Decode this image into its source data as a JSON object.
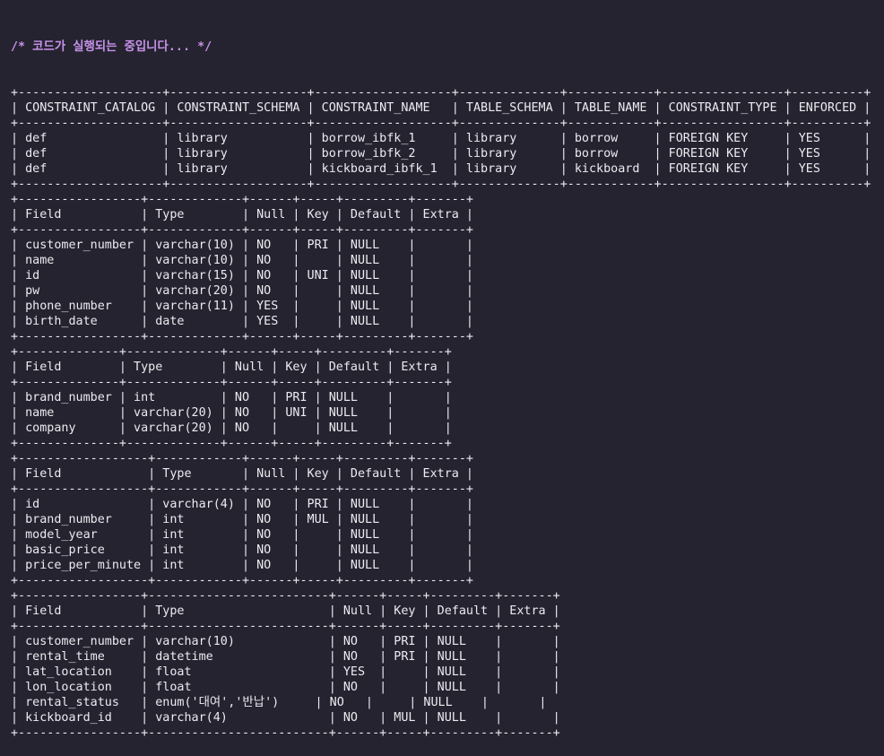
{
  "header": {
    "comment": "/* 코드가 실행되는 중입니다... */"
  },
  "results": [
    {
      "lines": [
        "+--------------------+-------------------+-------------------+--------------+------------+-----------------+----------+",
        "| CONSTRAINT_CATALOG | CONSTRAINT_SCHEMA | CONSTRAINT_NAME   | TABLE_SCHEMA | TABLE_NAME | CONSTRAINT_TYPE | ENFORCED |",
        "+--------------------+-------------------+-------------------+--------------+------------+-----------------+----------+",
        "| def                | library           | borrow_ibfk_1     | library      | borrow     | FOREIGN KEY     | YES      |",
        "| def                | library           | borrow_ibfk_2     | library      | borrow     | FOREIGN KEY     | YES      |",
        "| def                | library           | kickboard_ibfk_1  | library      | kickboard  | FOREIGN KEY     | YES      |",
        "+--------------------+-------------------+-------------------+--------------+------------+-----------------+----------+"
      ]
    },
    {
      "lines": [
        "+-----------------+-------------+------+-----+---------+-------+",
        "| Field           | Type        | Null | Key | Default | Extra |",
        "+-----------------+-------------+------+-----+---------+-------+",
        "| customer_number | varchar(10) | NO   | PRI | NULL    |       |",
        "| name            | varchar(10) | NO   |     | NULL    |       |",
        "| id              | varchar(15) | NO   | UNI | NULL    |       |",
        "| pw              | varchar(20) | NO   |     | NULL    |       |",
        "| phone_number    | varchar(11) | YES  |     | NULL    |       |",
        "| birth_date      | date        | YES  |     | NULL    |       |",
        "+-----------------+-------------+------+-----+---------+-------+"
      ]
    },
    {
      "lines": [
        "+--------------+-------------+------+-----+---------+-------+",
        "| Field        | Type        | Null | Key | Default | Extra |",
        "+--------------+-------------+------+-----+---------+-------+",
        "| brand_number | int         | NO   | PRI | NULL    |       |",
        "| name         | varchar(20) | NO   | UNI | NULL    |       |",
        "| company      | varchar(20) | NO   |     | NULL    |       |",
        "+--------------+-------------+------+-----+---------+-------+"
      ]
    },
    {
      "lines": [
        "+------------------+------------+------+-----+---------+-------+",
        "| Field            | Type       | Null | Key | Default | Extra |",
        "+------------------+------------+------+-----+---------+-------+",
        "| id               | varchar(4) | NO   | PRI | NULL    |       |",
        "| brand_number     | int        | NO   | MUL | NULL    |       |",
        "| model_year       | int        | NO   |     | NULL    |       |",
        "| basic_price      | int        | NO   |     | NULL    |       |",
        "| price_per_minute | int        | NO   |     | NULL    |       |",
        "+------------------+------------+------+-----+---------+-------+"
      ]
    },
    {
      "lines": [
        "+-----------------+-------------------------+------+-----+---------+-------+",
        "| Field           | Type                    | Null | Key | Default | Extra |",
        "+-----------------+-------------------------+------+-----+---------+-------+",
        "| customer_number | varchar(10)             | NO   | PRI | NULL    |       |",
        "| rental_time     | datetime                | NO   | PRI | NULL    |       |",
        "| lat_location    | float                   | YES  |     | NULL    |       |",
        "| lon_location    | float                   | NO   |     | NULL    |       |",
        "| rental_status   | enum('대여','반납')     | NO   |     | NULL    |       |",
        "| kickboard_id    | varchar(4)              | NO   | MUL | NULL    |       |",
        "+-----------------+-------------------------+------+-----+---------+-------+"
      ]
    }
  ]
}
